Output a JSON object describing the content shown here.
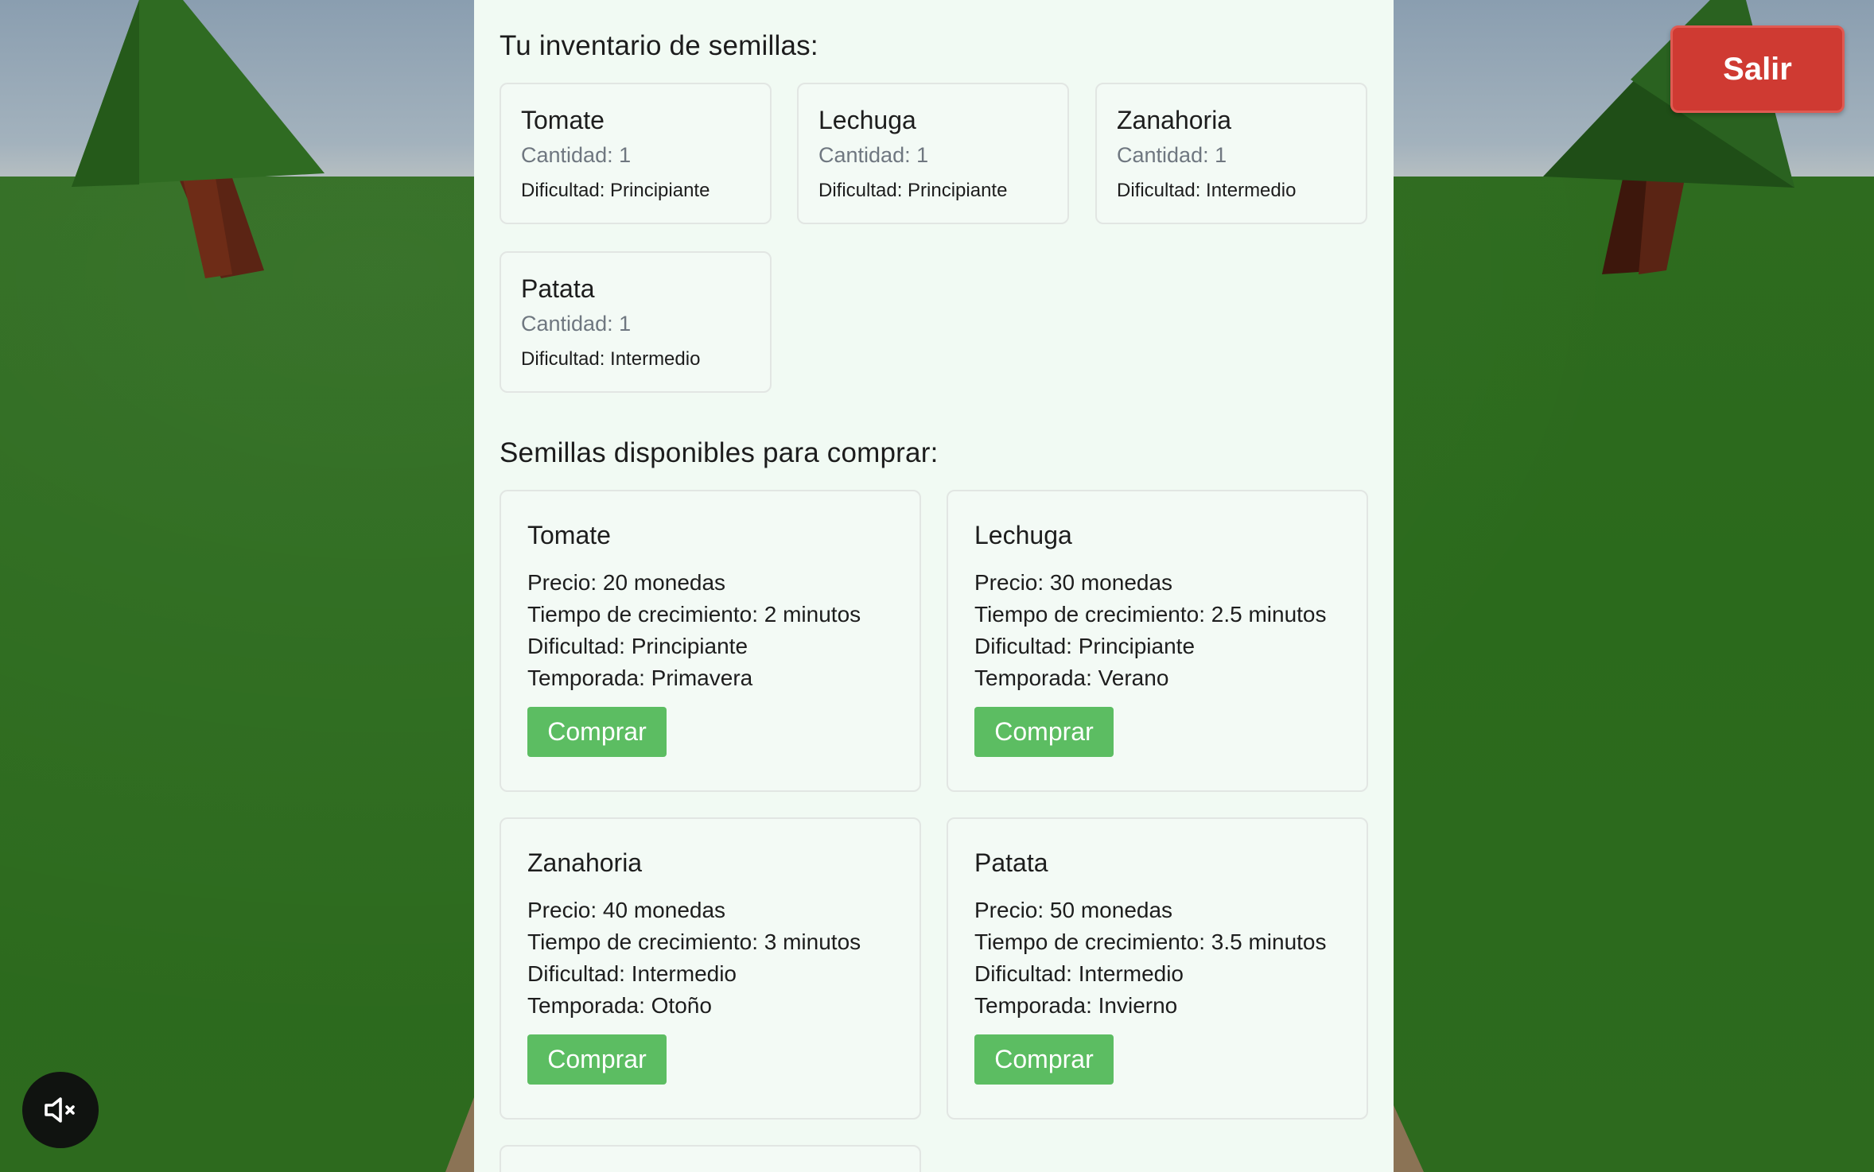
{
  "inventory": {
    "title": "Tu inventario de semillas:",
    "items": [
      {
        "name": "Tomate",
        "quantity": "Cantidad: 1",
        "difficulty": "Dificultad: Principiante"
      },
      {
        "name": "Lechuga",
        "quantity": "Cantidad: 1",
        "difficulty": "Dificultad: Principiante"
      },
      {
        "name": "Zanahoria",
        "quantity": "Cantidad: 1",
        "difficulty": "Dificultad: Intermedio"
      },
      {
        "name": "Patata",
        "quantity": "Cantidad: 1",
        "difficulty": "Dificultad: Intermedio"
      }
    ]
  },
  "shop": {
    "title": "Semillas disponibles para comprar:",
    "buy_label": "Comprar",
    "items": [
      {
        "name": "Tomate",
        "price": "Precio: 20 monedas",
        "growth": "Tiempo de crecimiento: 2 minutos",
        "difficulty": "Dificultad: Principiante",
        "season": "Temporada: Primavera"
      },
      {
        "name": "Lechuga",
        "price": "Precio: 30 monedas",
        "growth": "Tiempo de crecimiento: 2.5 minutos",
        "difficulty": "Dificultad: Principiante",
        "season": "Temporada: Verano"
      },
      {
        "name": "Zanahoria",
        "price": "Precio: 40 monedas",
        "growth": "Tiempo de crecimiento: 3 minutos",
        "difficulty": "Dificultad: Intermedio",
        "season": "Temporada: Otoño"
      },
      {
        "name": "Patata",
        "price": "Precio: 50 monedas",
        "growth": "Tiempo de crecimiento: 3.5 minutos",
        "difficulty": "Dificultad: Intermedio",
        "season": "Temporada: Invierno"
      }
    ]
  },
  "controls": {
    "exit_label": "Salir",
    "mute_icon": "speaker-muted-icon"
  },
  "colors": {
    "panel_bg": "#f1faf3",
    "buy_button": "#5cbd62",
    "exit_button": "#cf3a32",
    "grass": "#2d6a1e",
    "sky": "#a3b2bd"
  }
}
